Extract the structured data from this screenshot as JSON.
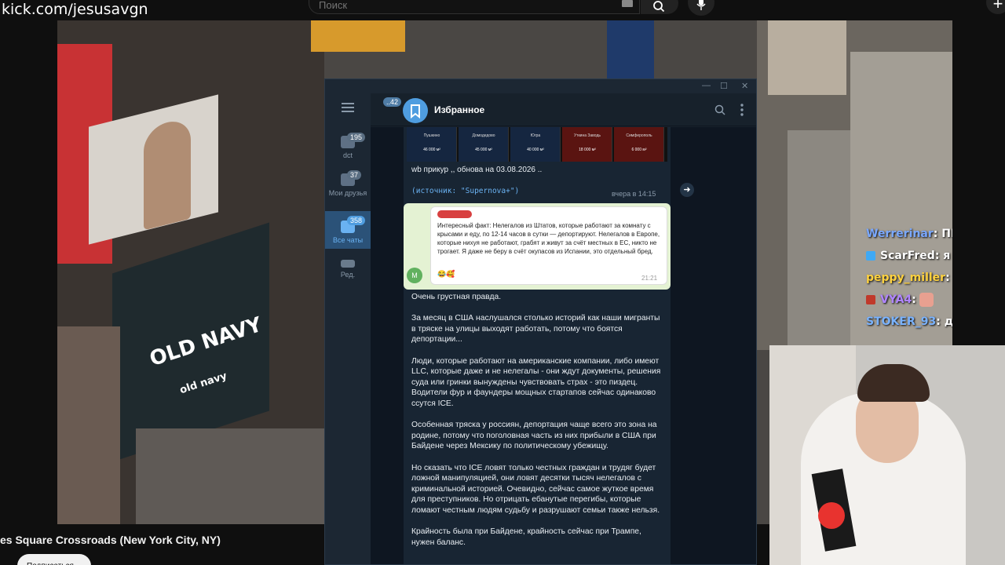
{
  "browser": {
    "url": "kick.com/jesusavgn",
    "search_placeholder": "Поиск"
  },
  "stream": {
    "title": "es Square Crossroads (New York City, NY)",
    "subscribe_label": "Подписаться"
  },
  "chat": {
    "messages": [
      {
        "user": "Werrerinar",
        "text": ": ПЕПСИ",
        "color": "#6aa9ff"
      },
      {
        "user": "ScarFred",
        "text": ": я кста акупас",
        "color": "#ffffff"
      },
      {
        "user": "peppy_miller",
        "text": ":",
        "color": "#ffd23f"
      },
      {
        "user": "VYA4",
        "text": ":",
        "color": "#b085ff"
      },
      {
        "user": "STOKER_93",
        "text": ": да",
        "color": "#7ab3ff"
      }
    ]
  },
  "telegram": {
    "chat_title": "Избранное",
    "back_badge": "..42",
    "rail": [
      {
        "label": "dct",
        "badge": "195"
      },
      {
        "label": "Мои друзья",
        "badge": "37"
      },
      {
        "label": "Все чаты",
        "badge": "358"
      },
      {
        "label": "Ред.",
        "badge": ""
      }
    ],
    "strip": [
      {
        "name": "Пушкино",
        "area": "46 000 м²"
      },
      {
        "name": "Домодедово",
        "area": "45 000 м²"
      },
      {
        "name": "Югра",
        "area": "40 000 м²"
      },
      {
        "name": "Уткина Заводь",
        "area": "18 000 м²"
      },
      {
        "name": "Симферополь",
        "area": "6 000 м²"
      }
    ],
    "wb_caption": "wb прикур ,, обнова на 03.08.2026 ..",
    "source_line": "(источник: \"Supernova+\")",
    "source_time": "вчера в 14:15",
    "quote": {
      "text": "Интересный факт: Нелегалов из Штатов, которые работают за комнату с крысами и еду, по 12-14 часов в сутки — депортируют. Нелегалов в Европе, которые нихуя не работают, грабят и живут за счёт местных в ЕС, никто не трогает. Я даже не беру в счёт окупасов из Испании, это отдельный бред.",
      "time": "21:21",
      "avatar_letter": "M"
    },
    "post_paragraphs": [
      "Очень грустная правда.",
      "За месяц в США наслушался столько историй как наши мигранты в тряске на улицы выходят работать, потому что боятся депортации...",
      "Люди, которые работают на американские компании, либо имеют LLC, которые даже и не нелегалы - они ждут документы, решения суда или гринки вынуждены чувствовать страх - это пиздец. Водители фур и фаундеры мощных стартапов сейчас одинаково ссутся ICE.",
      "Особенная тряска у россиян, депортация чаще всего это зона на родине, потому что поголовная часть из них прибыли в США при Байдене через Мексику по политическому убежищу.",
      "Но сказать что ICE ловят только честных граждан и трудяг будет ложной манипуляцией, они ловят десятки тысяч нелегалов с криминальной историей. Очевидно, сейчас самое жуткое время для преступников. Но отрицать ебанутые перегибы, которые ломают честным людям судьбу и разрушают семьи также нельзя.",
      "Крайность была при Байдене, крайность сейчас при Трампе, нужен баланс."
    ]
  }
}
